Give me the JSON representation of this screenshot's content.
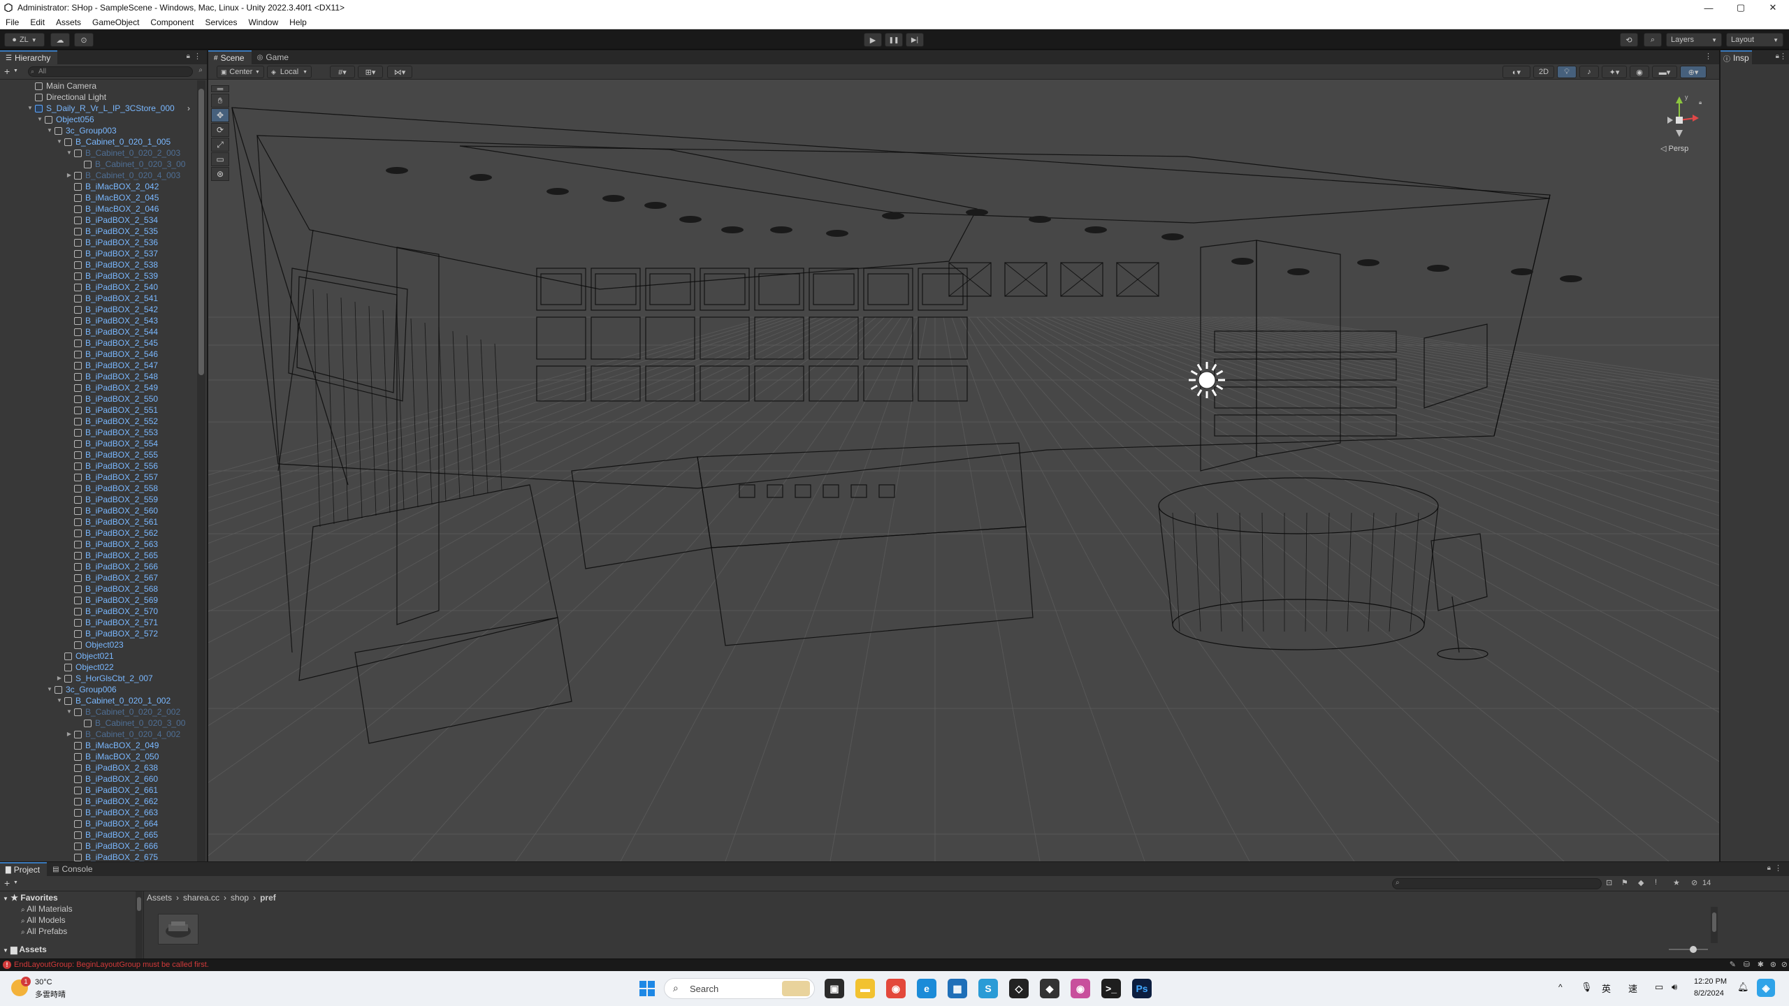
{
  "titlebar": {
    "title": "Administrator: SHop - SampleScene - Windows, Mac, Linux - Unity 2022.3.40f1 <DX11>",
    "minimize": "—",
    "maximize": "▢",
    "close": "✕"
  },
  "menu": [
    "File",
    "Edit",
    "Assets",
    "GameObject",
    "Component",
    "Services",
    "Window",
    "Help"
  ],
  "toolbar": {
    "account": "ZL",
    "play": "▶",
    "pause": "❚❚",
    "step": "▶|",
    "layers": "Layers",
    "layout": "Layout"
  },
  "hierarchy": {
    "tab": "Hierarchy",
    "search_placeholder": "All",
    "items": [
      {
        "label": "Main Camera",
        "indent": 0,
        "arrow": "",
        "kind": "obj"
      },
      {
        "label": "Directional Light",
        "indent": 0,
        "arrow": "",
        "kind": "obj"
      },
      {
        "label": "S_Daily_R_Vr_L_IP_3CStore_000",
        "indent": 0,
        "arrow": "▼",
        "kind": "prefab",
        "selected": false
      },
      {
        "label": "Object056",
        "indent": 1,
        "arrow": "▼",
        "kind": "blue"
      },
      {
        "label": "3c_Group003",
        "indent": 2,
        "arrow": "▼",
        "kind": "blue"
      },
      {
        "label": "B_Cabinet_0_020_1_005",
        "indent": 3,
        "arrow": "▼",
        "kind": "blue"
      },
      {
        "label": "B_Cabinet_0_020_2_003",
        "indent": 4,
        "arrow": "▼",
        "kind": "dimblue"
      },
      {
        "label": "B_Cabinet_0_020_3_00",
        "indent": 5,
        "arrow": "",
        "kind": "dimblue"
      },
      {
        "label": "B_Cabinet_0_020_4_003",
        "indent": 4,
        "arrow": "▶",
        "kind": "dimblue"
      },
      {
        "label": "B_iMacBOX_2_042",
        "indent": 4,
        "arrow": "",
        "kind": "blue"
      },
      {
        "label": "B_iMacBOX_2_045",
        "indent": 4,
        "arrow": "",
        "kind": "blue"
      },
      {
        "label": "B_iMacBOX_2_046",
        "indent": 4,
        "arrow": "",
        "kind": "blue"
      },
      {
        "label": "B_iPadBOX_2_534",
        "indent": 4,
        "arrow": "",
        "kind": "blue"
      },
      {
        "label": "B_iPadBOX_2_535",
        "indent": 4,
        "arrow": "",
        "kind": "blue"
      },
      {
        "label": "B_iPadBOX_2_536",
        "indent": 4,
        "arrow": "",
        "kind": "blue"
      },
      {
        "label": "B_iPadBOX_2_537",
        "indent": 4,
        "arrow": "",
        "kind": "blue"
      },
      {
        "label": "B_iPadBOX_2_538",
        "indent": 4,
        "arrow": "",
        "kind": "blue"
      },
      {
        "label": "B_iPadBOX_2_539",
        "indent": 4,
        "arrow": "",
        "kind": "blue"
      },
      {
        "label": "B_iPadBOX_2_540",
        "indent": 4,
        "arrow": "",
        "kind": "blue"
      },
      {
        "label": "B_iPadBOX_2_541",
        "indent": 4,
        "arrow": "",
        "kind": "blue"
      },
      {
        "label": "B_iPadBOX_2_542",
        "indent": 4,
        "arrow": "",
        "kind": "blue"
      },
      {
        "label": "B_iPadBOX_2_543",
        "indent": 4,
        "arrow": "",
        "kind": "blue"
      },
      {
        "label": "B_iPadBOX_2_544",
        "indent": 4,
        "arrow": "",
        "kind": "blue"
      },
      {
        "label": "B_iPadBOX_2_545",
        "indent": 4,
        "arrow": "",
        "kind": "blue"
      },
      {
        "label": "B_iPadBOX_2_546",
        "indent": 4,
        "arrow": "",
        "kind": "blue"
      },
      {
        "label": "B_iPadBOX_2_547",
        "indent": 4,
        "arrow": "",
        "kind": "blue"
      },
      {
        "label": "B_iPadBOX_2_548",
        "indent": 4,
        "arrow": "",
        "kind": "blue"
      },
      {
        "label": "B_iPadBOX_2_549",
        "indent": 4,
        "arrow": "",
        "kind": "blue"
      },
      {
        "label": "B_iPadBOX_2_550",
        "indent": 4,
        "arrow": "",
        "kind": "blue"
      },
      {
        "label": "B_iPadBOX_2_551",
        "indent": 4,
        "arrow": "",
        "kind": "blue"
      },
      {
        "label": "B_iPadBOX_2_552",
        "indent": 4,
        "arrow": "",
        "kind": "blue"
      },
      {
        "label": "B_iPadBOX_2_553",
        "indent": 4,
        "arrow": "",
        "kind": "blue"
      },
      {
        "label": "B_iPadBOX_2_554",
        "indent": 4,
        "arrow": "",
        "kind": "blue"
      },
      {
        "label": "B_iPadBOX_2_555",
        "indent": 4,
        "arrow": "",
        "kind": "blue"
      },
      {
        "label": "B_iPadBOX_2_556",
        "indent": 4,
        "arrow": "",
        "kind": "blue"
      },
      {
        "label": "B_iPadBOX_2_557",
        "indent": 4,
        "arrow": "",
        "kind": "blue"
      },
      {
        "label": "B_iPadBOX_2_558",
        "indent": 4,
        "arrow": "",
        "kind": "blue"
      },
      {
        "label": "B_iPadBOX_2_559",
        "indent": 4,
        "arrow": "",
        "kind": "blue"
      },
      {
        "label": "B_iPadBOX_2_560",
        "indent": 4,
        "arrow": "",
        "kind": "blue"
      },
      {
        "label": "B_iPadBOX_2_561",
        "indent": 4,
        "arrow": "",
        "kind": "blue"
      },
      {
        "label": "B_iPadBOX_2_562",
        "indent": 4,
        "arrow": "",
        "kind": "blue"
      },
      {
        "label": "B_iPadBOX_2_563",
        "indent": 4,
        "arrow": "",
        "kind": "blue"
      },
      {
        "label": "B_iPadBOX_2_565",
        "indent": 4,
        "arrow": "",
        "kind": "blue"
      },
      {
        "label": "B_iPadBOX_2_566",
        "indent": 4,
        "arrow": "",
        "kind": "blue"
      },
      {
        "label": "B_iPadBOX_2_567",
        "indent": 4,
        "arrow": "",
        "kind": "blue"
      },
      {
        "label": "B_iPadBOX_2_568",
        "indent": 4,
        "arrow": "",
        "kind": "blue"
      },
      {
        "label": "B_iPadBOX_2_569",
        "indent": 4,
        "arrow": "",
        "kind": "blue"
      },
      {
        "label": "B_iPadBOX_2_570",
        "indent": 4,
        "arrow": "",
        "kind": "blue"
      },
      {
        "label": "B_iPadBOX_2_571",
        "indent": 4,
        "arrow": "",
        "kind": "blue"
      },
      {
        "label": "B_iPadBOX_2_572",
        "indent": 4,
        "arrow": "",
        "kind": "blue"
      },
      {
        "label": "Object023",
        "indent": 4,
        "arrow": "",
        "kind": "blue"
      },
      {
        "label": "Object021",
        "indent": 3,
        "arrow": "",
        "kind": "blue"
      },
      {
        "label": "Object022",
        "indent": 3,
        "arrow": "",
        "kind": "blue"
      },
      {
        "label": "S_HorGlsCbt_2_007",
        "indent": 3,
        "arrow": "▶",
        "kind": "blue"
      },
      {
        "label": "3c_Group006",
        "indent": 2,
        "arrow": "▼",
        "kind": "blue"
      },
      {
        "label": "B_Cabinet_0_020_1_002",
        "indent": 3,
        "arrow": "▼",
        "kind": "blue"
      },
      {
        "label": "B_Cabinet_0_020_2_002",
        "indent": 4,
        "arrow": "▼",
        "kind": "dimblue"
      },
      {
        "label": "B_Cabinet_0_020_3_00",
        "indent": 5,
        "arrow": "",
        "kind": "dimblue"
      },
      {
        "label": "B_Cabinet_0_020_4_002",
        "indent": 4,
        "arrow": "▶",
        "kind": "dimblue"
      },
      {
        "label": "B_iMacBOX_2_049",
        "indent": 4,
        "arrow": "",
        "kind": "blue"
      },
      {
        "label": "B_iMacBOX_2_050",
        "indent": 4,
        "arrow": "",
        "kind": "blue"
      },
      {
        "label": "B_iPadBOX_2_638",
        "indent": 4,
        "arrow": "",
        "kind": "blue"
      },
      {
        "label": "B_iPadBOX_2_660",
        "indent": 4,
        "arrow": "",
        "kind": "blue"
      },
      {
        "label": "B_iPadBOX_2_661",
        "indent": 4,
        "arrow": "",
        "kind": "blue"
      },
      {
        "label": "B_iPadBOX_2_662",
        "indent": 4,
        "arrow": "",
        "kind": "blue"
      },
      {
        "label": "B_iPadBOX_2_663",
        "indent": 4,
        "arrow": "",
        "kind": "blue"
      },
      {
        "label": "B_iPadBOX_2_664",
        "indent": 4,
        "arrow": "",
        "kind": "blue"
      },
      {
        "label": "B_iPadBOX_2_665",
        "indent": 4,
        "arrow": "",
        "kind": "blue"
      },
      {
        "label": "B_iPadBOX_2_666",
        "indent": 4,
        "arrow": "",
        "kind": "blue"
      },
      {
        "label": "B_iPadBOX_2_675",
        "indent": 4,
        "arrow": "",
        "kind": "blue"
      }
    ]
  },
  "scene": {
    "tabs": [
      "Scene",
      "Game"
    ],
    "pivot": "Center",
    "space": "Local",
    "mode_2d": "2D",
    "gizmo_axis": "y",
    "projection": "Persp"
  },
  "inspector": {
    "tab": "Insp"
  },
  "project": {
    "tabs": [
      "Project",
      "Console"
    ],
    "favorites_label": "Favorites",
    "favorites": [
      "All Materials",
      "All Models",
      "All Prefabs"
    ],
    "assets_label": "Assets",
    "breadcrumb": [
      "Assets",
      "sharea.cc",
      "shop",
      "pref"
    ],
    "hidden_count": "14"
  },
  "status": {
    "error": "EndLayoutGroup: BeginLayoutGroup must be called first.",
    "error_color": "#d23a3a"
  },
  "taskbar": {
    "weather_temp": "30°C",
    "weather_desc": "多雲時晴",
    "weather_badge": "1",
    "search_placeholder": "Search",
    "ime": "英",
    "ime2": "速",
    "time": "12:20 PM",
    "date": "8/2/2024"
  },
  "colors": {
    "accent": "#3a79bb",
    "prefab_blue": "#7ab8ff",
    "wire": "#0d0d0d",
    "grid": "#5a5a5a"
  }
}
